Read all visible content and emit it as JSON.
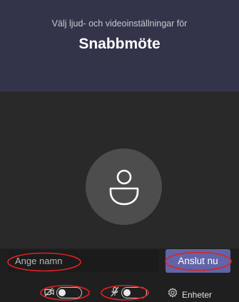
{
  "header": {
    "subtitle": "Välj ljud- och videoinställningar för",
    "title": "Snabbmöte"
  },
  "name_input": {
    "placeholder": "Ange namn",
    "value": ""
  },
  "join_button": {
    "label": "Anslut nu"
  },
  "controls": {
    "camera": {
      "icon": "camera-off-icon",
      "on": false
    },
    "microphone": {
      "icon": "mic-off-icon",
      "on": false
    },
    "devices": {
      "icon": "gear-icon",
      "label": "Enheter"
    }
  },
  "colors": {
    "header_bg": "#33344a",
    "accent": "#6264a7",
    "annotation": "#e02020"
  }
}
